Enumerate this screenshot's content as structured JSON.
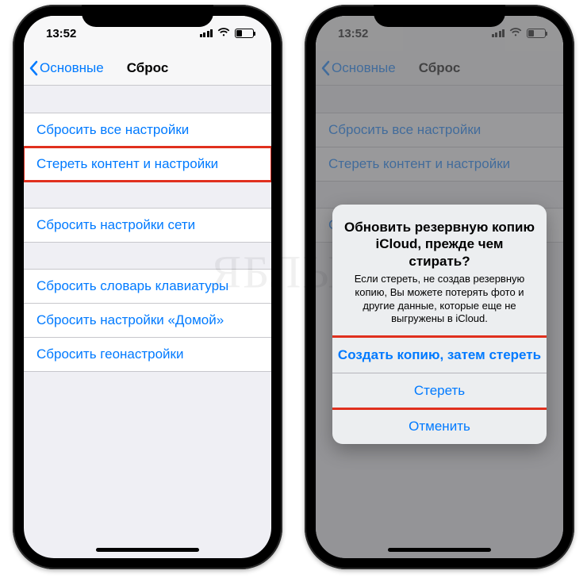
{
  "status": {
    "time": "13:52"
  },
  "nav": {
    "back": "Основные",
    "title": "Сброс"
  },
  "rows": {
    "reset_all": "Сбросить все настройки",
    "erase_content": "Стереть контент и настройки",
    "reset_network": "Сбросить настройки сети",
    "reset_keyboard": "Сбросить словарь клавиатуры",
    "reset_home": "Сбросить настройки «Домой»",
    "reset_location": "Сбросить геонастройки"
  },
  "alert": {
    "title": "Обновить резервную копию iCloud, прежде чем стирать?",
    "message": "Если стереть, не создав резервную копию, Вы можете потерять фото и другие данные, которые еще не выгружены в iCloud.",
    "backup_then_erase": "Создать копию, затем стереть",
    "erase": "Стереть",
    "cancel": "Отменить"
  },
  "watermark": "ЯБЛЫК"
}
